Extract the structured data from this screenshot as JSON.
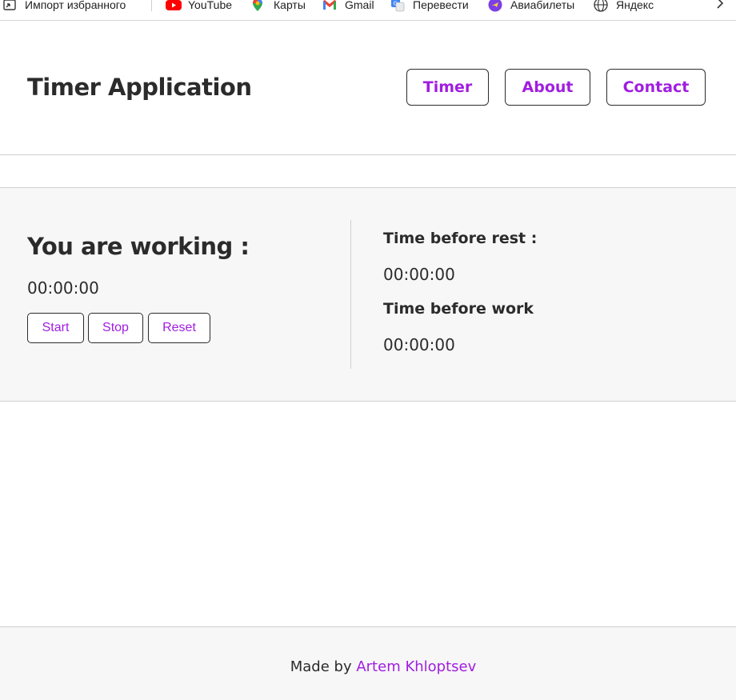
{
  "bookmarks": {
    "items": [
      {
        "label": "Импорт избранного",
        "icon": "import-icon"
      },
      {
        "label": "YouTube",
        "icon": "youtube-icon"
      },
      {
        "label": "Карты",
        "icon": "maps-pin-icon"
      },
      {
        "label": "Gmail",
        "icon": "gmail-icon"
      },
      {
        "label": "Перевести",
        "icon": "translate-icon"
      },
      {
        "label": "Авиабилеты",
        "icon": "airplane-icon"
      },
      {
        "label": "Яндекс",
        "icon": "globe-icon"
      }
    ],
    "more_icon": "chevron-right-icon"
  },
  "header": {
    "title": "Timer Application",
    "nav": [
      "Timer",
      "About",
      "Contact"
    ]
  },
  "work_panel": {
    "heading": "You are working :",
    "time": "00:00:00",
    "buttons": [
      "Start",
      "Stop",
      "Reset"
    ]
  },
  "status_panel": {
    "rest_label": "Time before rest :",
    "rest_time": "00:00:00",
    "work_label": "Time before work",
    "work_time": "00:00:00"
  },
  "footer": {
    "prefix": "Made by",
    "author": "Artem Khloptsev"
  },
  "colors": {
    "accent": "#a01ee0",
    "text": "#2b2b2b",
    "panel_bg": "#f7f7f7"
  }
}
